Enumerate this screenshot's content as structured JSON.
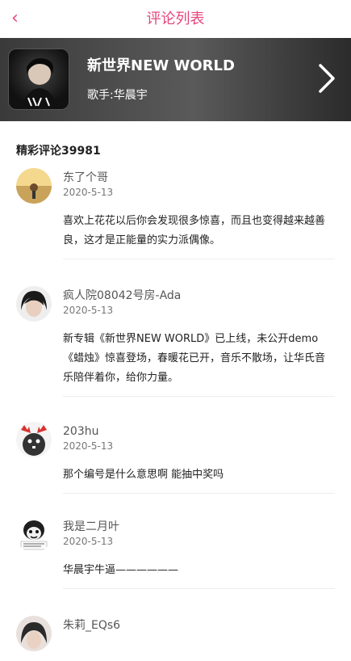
{
  "nav": {
    "title": "评论列表",
    "back_icon": "‹"
  },
  "album": {
    "name": "新世界NEW WORLD",
    "singer": "歌手:华晨宇"
  },
  "comments_header": "精彩评论39981",
  "comments": [
    {
      "user": "东了个哥",
      "date": "2020-5-13",
      "text": "喜欢上花花以后你会发现很多惊喜，而且也变得越来越善良，这才是正能量的实力派偶像。"
    },
    {
      "user": "疯人院08042号房-Ada",
      "date": "2020-5-13",
      "text": "新专辑《新世界NEW WORLD》已上线，未公开demo《蜡烛》惊喜登场，春暖花已开，音乐不散场，让华氏音乐陪伴着你，给你力量。"
    },
    {
      "user": "203hu",
      "date": "2020-5-13",
      "text": "那个编号是什么意思啊 能抽中奖吗"
    },
    {
      "user": "我是二月叶",
      "date": "2020-5-13",
      "text": "华晨宇牛逼——————"
    },
    {
      "user": "朱莉_EQs6",
      "date": "",
      "text": ""
    }
  ],
  "colors": {
    "accent": "#e8457a"
  }
}
